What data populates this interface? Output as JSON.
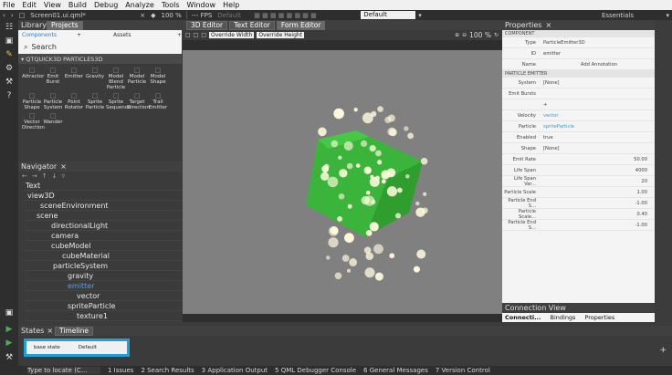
{
  "menu": [
    "File",
    "Edit",
    "View",
    "Build",
    "Debug",
    "Analyze",
    "Tools",
    "Window",
    "Help"
  ],
  "toolbar": {
    "file": "Screen01.ui.qml*",
    "zoom": "100 %",
    "fps": "--- FPS",
    "fps_default": "Default",
    "style": "Default",
    "workspace": "Essentials"
  },
  "library": {
    "title": "Library",
    "tab_projects": "Projects",
    "sub_components": "Components",
    "sub_assets": "Assets",
    "search_placeholder": "Search",
    "section": "QTQUICK3D PARTICLES3D",
    "items": [
      "Attractor",
      "Emit Burst",
      "Emitter",
      "Gravity",
      "Model Blend Particle",
      "Model Particle",
      "Model Shape",
      "Particle Shape",
      "Particle System",
      "Point Rotator",
      "Sprite Particle",
      "Sprite Sequence",
      "Target Direction",
      "Trail Emitter",
      "Vector Direction",
      "Wander"
    ]
  },
  "navigator": {
    "title": "Navigator",
    "items": [
      "Text",
      "view3D",
      "sceneEnvironment",
      "scene",
      "directionalLight",
      "camera",
      "cubeModel",
      "cubeMaterial",
      "particleSystem",
      "gravity",
      "emitter",
      "vector",
      "spriteParticle",
      "texture1"
    ]
  },
  "editor": {
    "tab_3d": "3D Editor",
    "tab_text": "Text Editor",
    "tab_form": "Form Editor",
    "override_width": "Override Width",
    "override_height": "Override Height",
    "zoom": "100 %"
  },
  "properties": {
    "title": "Properties",
    "component": "COMPONENT",
    "type_label": "Type",
    "type_value": "ParticleEmitter3D",
    "id_label": "ID",
    "id_value": "emitter",
    "name_label": "Name",
    "add_annotation": "Add Annotation",
    "emitter_section": "PARTICLE EMITTER",
    "rows": [
      {
        "label": "System",
        "value": "[None]"
      },
      {
        "label": "Emit Bursts",
        "value": ""
      },
      {
        "label": "",
        "value": "+"
      },
      {
        "label": "Velocity",
        "value": "vector"
      },
      {
        "label": "Particle",
        "value": "spriteParticle"
      },
      {
        "label": "Enabled",
        "value": "true"
      },
      {
        "label": "Shape",
        "value": "[None]"
      },
      {
        "label": "Emit Rate",
        "value": "50.00"
      },
      {
        "label": "Life Span",
        "value": "4000"
      },
      {
        "label": "Life Span Var...",
        "value": "20"
      },
      {
        "label": "Particle Scale",
        "value": "1.00"
      },
      {
        "label": "Particle End S...",
        "value": "-1.00"
      },
      {
        "label": "Particle Scale...",
        "value": "0.40"
      },
      {
        "label": "Particle End S...",
        "value": "-1.00"
      }
    ]
  },
  "connection": {
    "title": "Connection View",
    "tabs": [
      "Connecti...",
      "Bindings",
      "Properties"
    ]
  },
  "states": {
    "tab_states": "States",
    "tab_timeline": "Timeline",
    "base_state": "base state",
    "default": "Default"
  },
  "status": {
    "locate": "Type to locate (C...",
    "items": [
      "1 Issues",
      "2 Search Results",
      "3 Application Output",
      "5 QML Debugger Console",
      "6 General Messages",
      "7 Version Control"
    ]
  }
}
